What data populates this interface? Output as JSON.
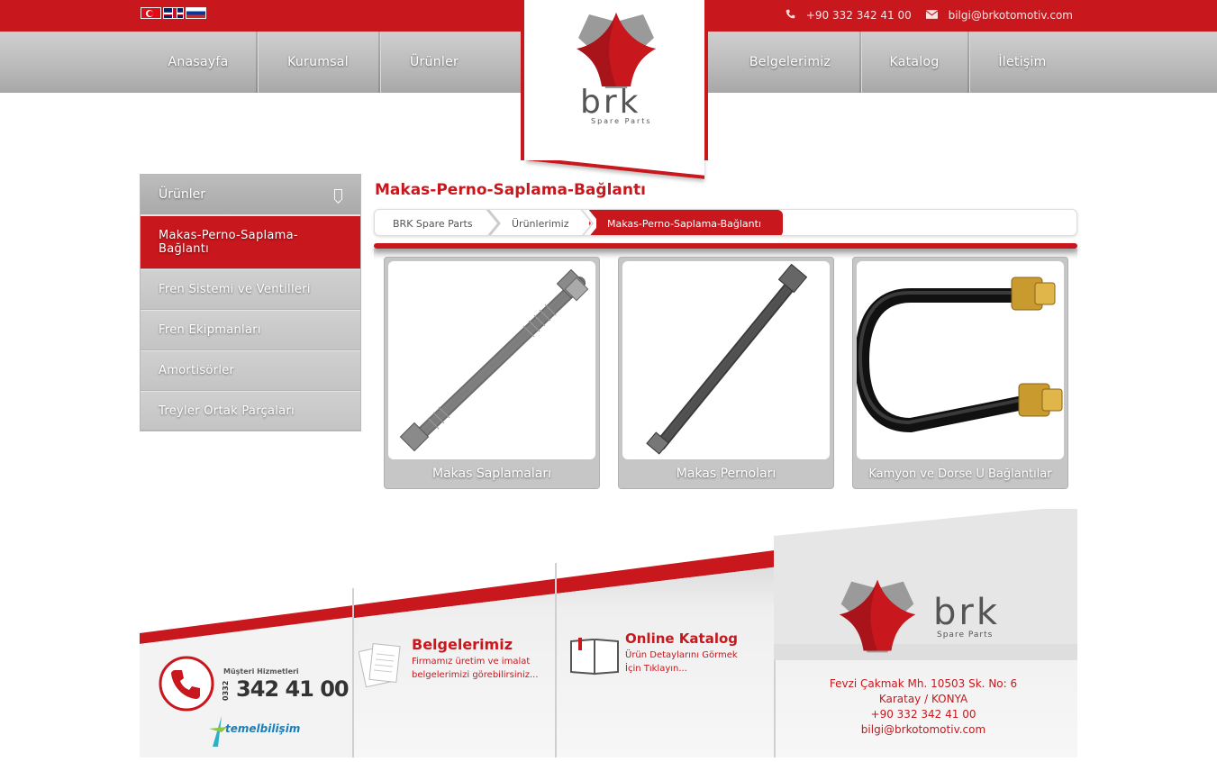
{
  "topbar": {
    "languages": [
      "Türkçe",
      "English",
      "Русский"
    ],
    "phone": "+90 332 342 41 00",
    "email": "bilgi@brkotomotiv.com"
  },
  "nav": {
    "items": [
      "Anasayfa",
      "Kurumsal",
      "Ürünler",
      "Belgelerimiz",
      "Katalog",
      "İletişim"
    ]
  },
  "logo": {
    "brand": "brk",
    "tagline": "Spare Parts"
  },
  "sidebar": {
    "title": "Ürünler",
    "items": [
      "Makas-Perno-Saplama-Bağlantı",
      "Fren Sistemi ve Ventilleri",
      "Fren Ekipmanları",
      "Amortisörler",
      "Treyler Ortak Parçaları"
    ]
  },
  "main": {
    "title": "Makas-Perno-Saplama-Bağlantı",
    "breadcrumb": [
      "BRK Spare Parts",
      "Ürünlerimiz",
      "Makas-Perno-Saplama-Bağlantı"
    ],
    "products": [
      "Makas Saplamaları",
      "Makas Pernoları",
      "Kamyon ve Dorse U Bağlantılar"
    ]
  },
  "footer": {
    "support_label": "Müşteri Hizmetleri",
    "support_prefix": "0332",
    "support_number": "342 41 00",
    "developer": "temelbilişim",
    "certs_title": "Belgelerimiz",
    "certs_desc": "Firmamız üretim ve imalat belgelerimizi görebilirsiniz...",
    "catalog_title": "Online Katalog",
    "catalog_desc": "Ürün Detaylarını Görmek İçin Tıklayın...",
    "brand": "brk",
    "tagline": "Spare Parts",
    "address_line1": "Fevzi Çakmak Mh. 10503 Sk. No: 6",
    "address_line2": "Karatay / KONYA",
    "phone": "+90 332 342 41 00",
    "email": "bilgi@brkotomotiv.com"
  },
  "colors": {
    "brand_red": "#c8171d",
    "nav_gray": "#b9b9b9"
  }
}
